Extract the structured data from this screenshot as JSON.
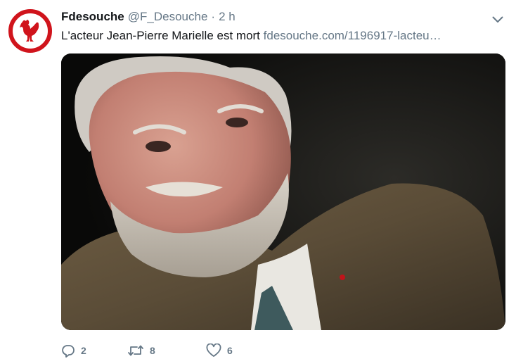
{
  "tweet": {
    "author_name": "Fdesouche",
    "author_handle": "@F_Desouche",
    "separator": "·",
    "time": "2 h",
    "text": "L'acteur Jean-Pierre Marielle est mort ",
    "link": "fdesouche.com/1196917-lacteu…",
    "replies": "2",
    "retweets": "8",
    "likes": "6"
  },
  "colors": {
    "brand_red": "#d0141c",
    "secondary_text": "#657786",
    "primary_text": "#14171a"
  },
  "icons": {
    "avatar": "rooster-logo-icon",
    "menu": "chevron-down-icon",
    "reply": "reply-bubble-icon",
    "retweet": "retweet-icon",
    "like": "heart-icon"
  }
}
